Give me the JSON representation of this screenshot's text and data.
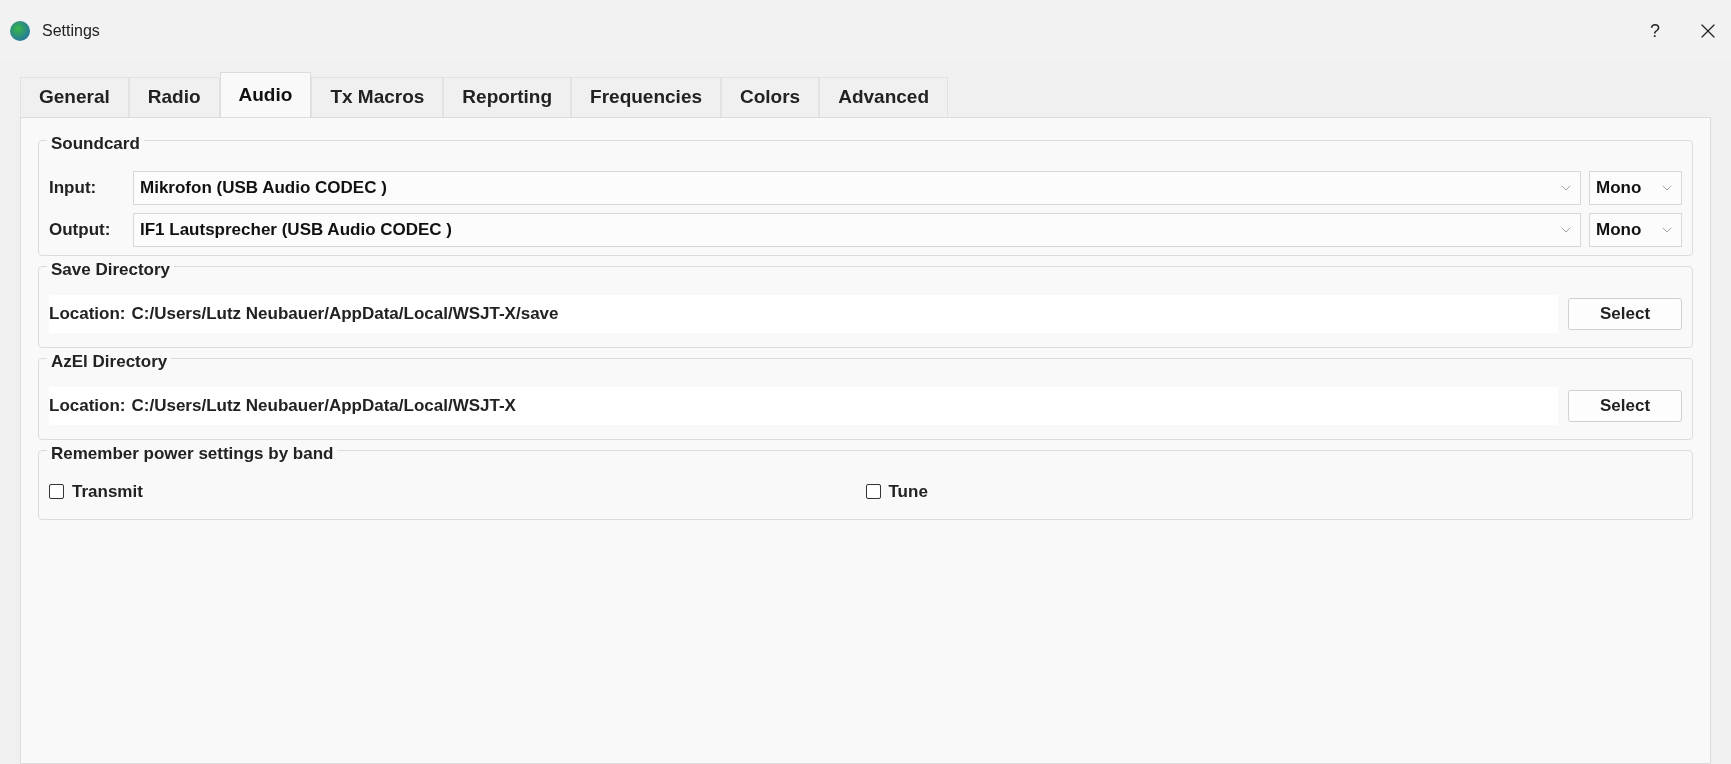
{
  "window": {
    "title": "Settings",
    "help": "?"
  },
  "tabs": [
    {
      "label": "General",
      "selected": false
    },
    {
      "label": "Radio",
      "selected": false
    },
    {
      "label": "Audio",
      "selected": true
    },
    {
      "label": "Tx Macros",
      "selected": false
    },
    {
      "label": "Reporting",
      "selected": false
    },
    {
      "label": "Frequencies",
      "selected": false
    },
    {
      "label": "Colors",
      "selected": false
    },
    {
      "label": "Advanced",
      "selected": false
    }
  ],
  "soundcard": {
    "title": "Soundcard",
    "rows": [
      {
        "label": "Input:",
        "device": "Mikrofon (USB Audio CODEC )",
        "channel": "Mono"
      },
      {
        "label": "Output:",
        "device": "IF1 Lautsprecher (USB Audio CODEC )",
        "channel": "Mono"
      }
    ]
  },
  "directories": [
    {
      "title": "Save Directory",
      "label": "Location:",
      "path": "C:/Users/Lutz Neubauer/AppData/Local/WSJT-X/save",
      "button": "Select"
    },
    {
      "title": "AzEl Directory",
      "label": "Location:",
      "path": "C:/Users/Lutz Neubauer/AppData/Local/WSJT-X",
      "button": "Select"
    }
  ],
  "power": {
    "title": "Remember power settings by band",
    "options": [
      {
        "label": "Transmit",
        "checked": false
      },
      {
        "label": "Tune",
        "checked": false
      }
    ]
  }
}
